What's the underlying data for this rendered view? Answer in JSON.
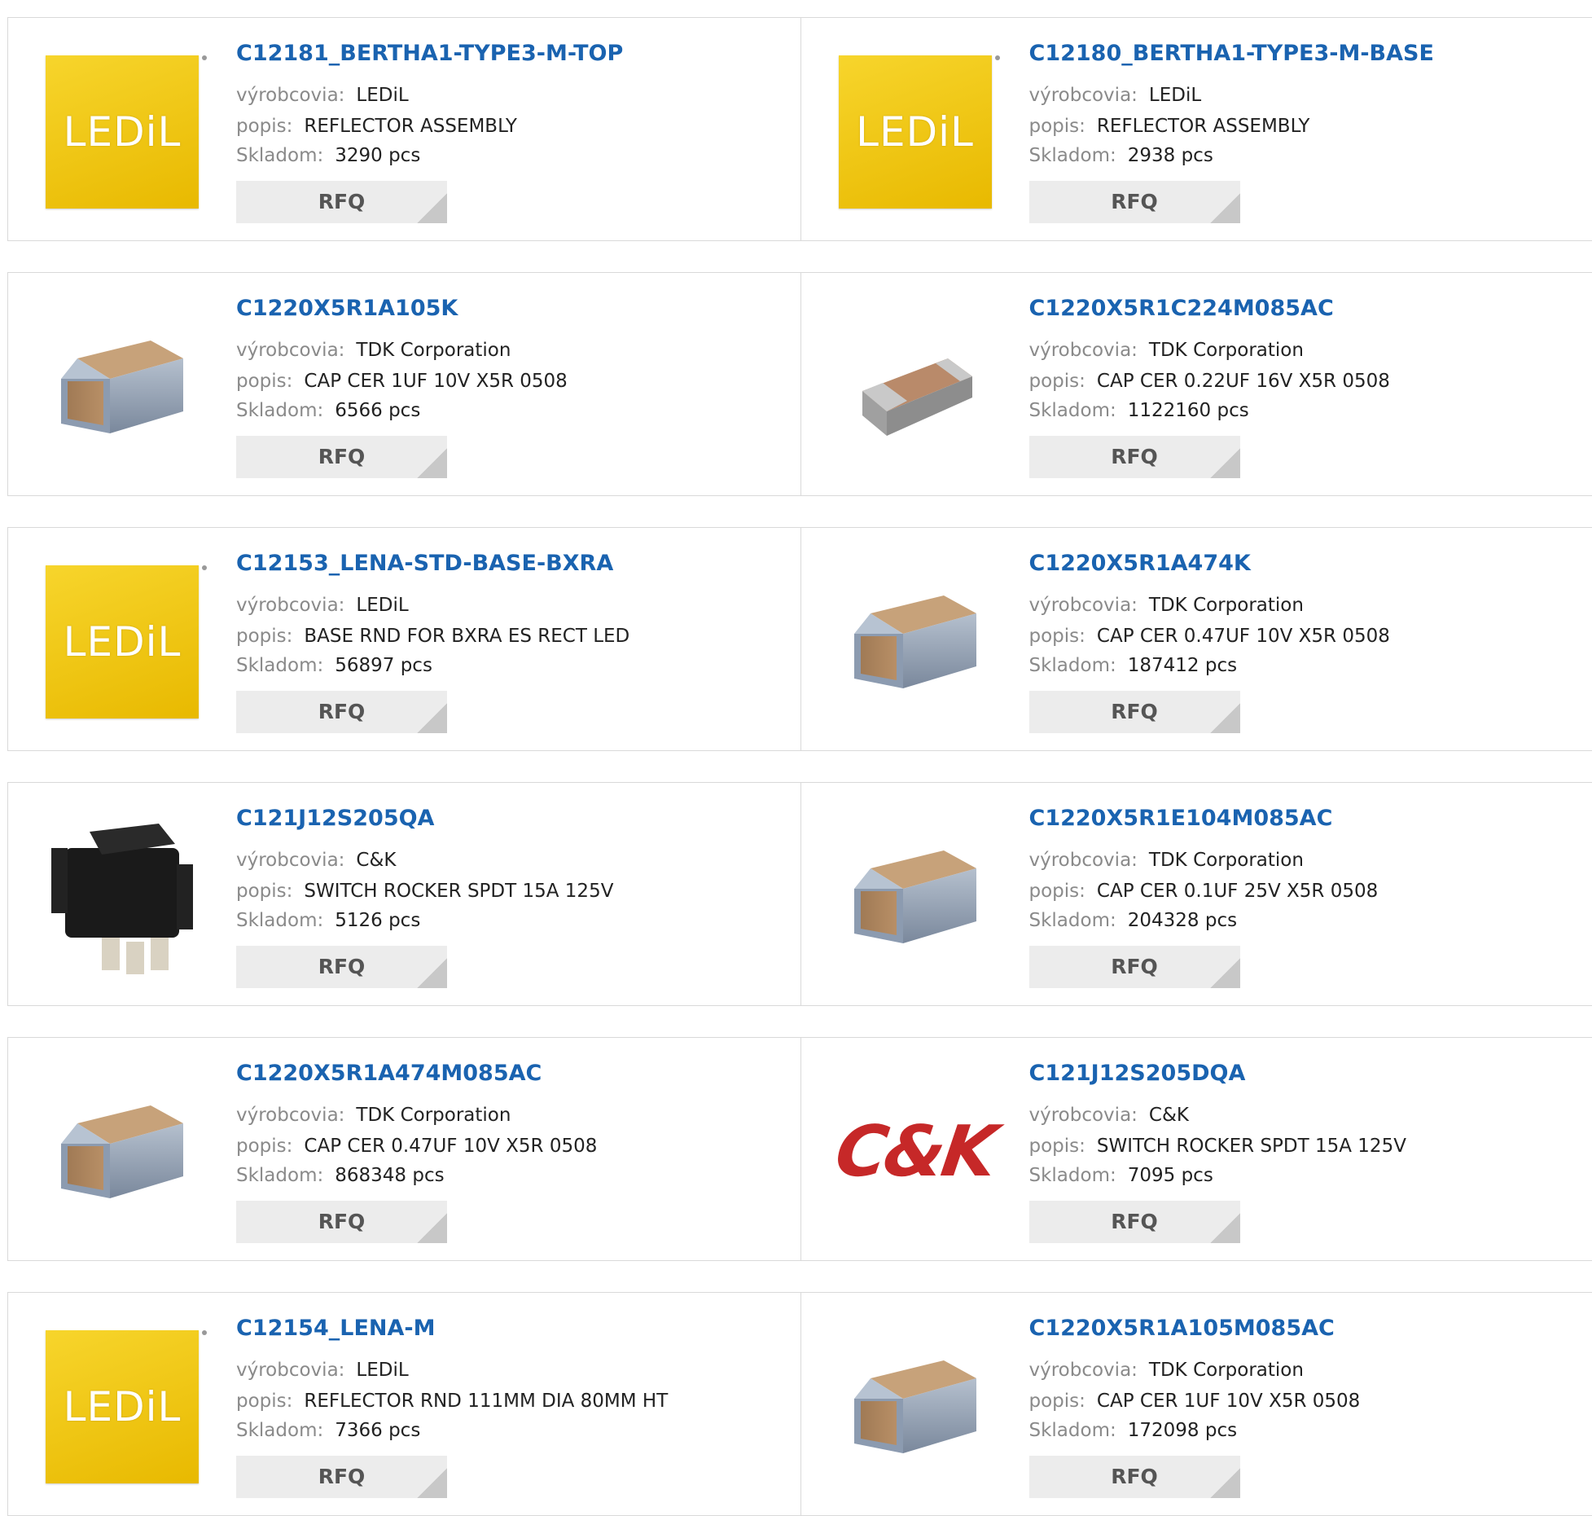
{
  "labels": {
    "manufacturer": "výrobcovia:",
    "description": "popis:",
    "stock": "Skladom:",
    "rfq": "RFQ"
  },
  "products": [
    {
      "part": "C12181_BERTHA1-TYPE3-M-TOP",
      "manufacturer": "LEDiL",
      "description": "REFLECTOR ASSEMBLY",
      "stock": "3290 pcs",
      "image": "ledil-logo"
    },
    {
      "part": "C12180_BERTHA1-TYPE3-M-BASE",
      "manufacturer": "LEDiL",
      "description": "REFLECTOR ASSEMBLY",
      "stock": "2938 pcs",
      "image": "ledil-logo"
    },
    {
      "part": "C1220X5R1A105K",
      "manufacturer": "TDK Corporation",
      "description": "CAP CER 1UF 10V X5R 0508",
      "stock": "6566 pcs",
      "image": "capacitor-chip"
    },
    {
      "part": "C1220X5R1C224M085AC",
      "manufacturer": "TDK Corporation",
      "description": "CAP CER 0.22UF 16V X5R 0508",
      "stock": "1122160 pcs",
      "image": "capacitor-chip-flat"
    },
    {
      "part": "C12153_LENA-STD-BASE-BXRA",
      "manufacturer": "LEDiL",
      "description": "BASE RND FOR BXRA ES RECT LED",
      "stock": "56897 pcs",
      "image": "ledil-logo"
    },
    {
      "part": "C1220X5R1A474K",
      "manufacturer": "TDK Corporation",
      "description": "CAP CER 0.47UF 10V X5R 0508",
      "stock": "187412 pcs",
      "image": "capacitor-chip"
    },
    {
      "part": "C121J12S205QA",
      "manufacturer": "C&K",
      "description": "SWITCH ROCKER SPDT 15A 125V",
      "stock": "5126 pcs",
      "image": "rocker-switch"
    },
    {
      "part": "C1220X5R1E104M085AC",
      "manufacturer": "TDK Corporation",
      "description": "CAP CER 0.1UF 25V X5R 0508",
      "stock": "204328 pcs",
      "image": "capacitor-chip"
    },
    {
      "part": "C1220X5R1A474M085AC",
      "manufacturer": "TDK Corporation",
      "description": "CAP CER 0.47UF 10V X5R 0508",
      "stock": "868348 pcs",
      "image": "capacitor-chip"
    },
    {
      "part": "C121J12S205DQA",
      "manufacturer": "C&K",
      "description": "SWITCH ROCKER SPDT 15A 125V",
      "stock": "7095 pcs",
      "image": "ck-logo"
    },
    {
      "part": "C12154_LENA-M",
      "manufacturer": "LEDiL",
      "description": "REFLECTOR RND 111MM DIA 80MM HT",
      "stock": "7366 pcs",
      "image": "ledil-logo"
    },
    {
      "part": "C1220X5R1A105M085AC",
      "manufacturer": "TDK Corporation",
      "description": "CAP CER 1UF 10V X5R 0508",
      "stock": "172098 pcs",
      "image": "capacitor-chip"
    }
  ],
  "logos": {
    "ledil": "LEDiL",
    "ck": "C&K"
  },
  "colors": {
    "link": "#1a63b0",
    "ledil_yellow": "#f2c81a",
    "ck_red": "#c62828",
    "rfq_bg": "#ececec"
  }
}
